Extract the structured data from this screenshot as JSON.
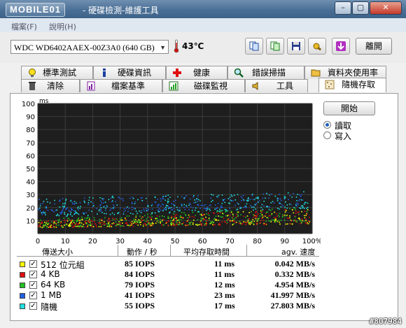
{
  "window": {
    "logo": "MOBILE01",
    "title": "- 硬碟檢測-維護工具"
  },
  "menu": [
    "檔案(F)",
    "說明(H)"
  ],
  "toolbar": {
    "drive": "WDC WD6402AAEX-00Z3A0 (640 GB)",
    "temperature": "43℃",
    "exit_label": "離開"
  },
  "tabs_row1": [
    "標準測試",
    "硬碟資訊",
    "健康",
    "錯誤掃描",
    "資料夾使用率"
  ],
  "tabs_row2": [
    "清除",
    "檔案基準",
    "磁碟監視",
    "工具",
    "隨機存取"
  ],
  "controls": {
    "start_label": "開始",
    "read_label": "讀取",
    "write_label": "寫入",
    "mode": "read"
  },
  "stats": {
    "headers": [
      "傳送大小",
      "動作 / 秒",
      "平均存取時間",
      "agv. 速度"
    ],
    "rows": [
      {
        "name": "512 位元組",
        "color": "#ffff00",
        "iops": "85 IOPS",
        "time": "11 ms",
        "speed": "0.042 MB/s",
        "checked": true
      },
      {
        "name": "4 KB",
        "color": "#e01010",
        "iops": "84 IOPS",
        "time": "11 ms",
        "speed": "0.332 MB/s",
        "checked": true
      },
      {
        "name": "64 KB",
        "color": "#20c020",
        "iops": "79 IOPS",
        "time": "12 ms",
        "speed": "4.954 MB/s",
        "checked": true
      },
      {
        "name": "1 MB",
        "color": "#2060e0",
        "iops": "41 IOPS",
        "time": "23 ms",
        "speed": "41.997 MB/s",
        "checked": true
      },
      {
        "name": "隨機",
        "color": "#20e0e0",
        "iops": "55 IOPS",
        "time": "17 ms",
        "speed": "27.803 MB/s",
        "checked": true
      }
    ]
  },
  "chart_data": {
    "type": "scatter",
    "ylabel": "ms",
    "ylim": [
      0,
      100
    ],
    "xlim": [
      0,
      100
    ],
    "x_ticks": [
      "0",
      "10",
      "20",
      "30",
      "40",
      "50",
      "60",
      "70",
      "80",
      "90",
      "100%"
    ],
    "y_ticks": [
      "10",
      "20",
      "30",
      "40",
      "50",
      "60",
      "70",
      "80",
      "90",
      "100"
    ],
    "grid": true,
    "series": [
      {
        "name": "512 位元組",
        "color": "#ffff00",
        "ymin_start": 5,
        "ymin_end": 8,
        "ymax_start": 10,
        "ymax_end": 20
      },
      {
        "name": "4 KB",
        "color": "#e01010",
        "ymin_start": 5,
        "ymin_end": 8,
        "ymax_start": 10,
        "ymax_end": 20
      },
      {
        "name": "64 KB",
        "color": "#20c020",
        "ymin_start": 5,
        "ymin_end": 9,
        "ymax_start": 12,
        "ymax_end": 21
      },
      {
        "name": "1 MB",
        "color": "#2060e0",
        "ymin_start": 15,
        "ymin_end": 22,
        "ymax_start": 27,
        "ymax_end": 32
      },
      {
        "name": "隨機",
        "color": "#20e0e0",
        "ymin_start": 13,
        "ymin_end": 20,
        "ymax_start": 28,
        "ymax_end": 33
      }
    ]
  },
  "watermark": "#807984"
}
